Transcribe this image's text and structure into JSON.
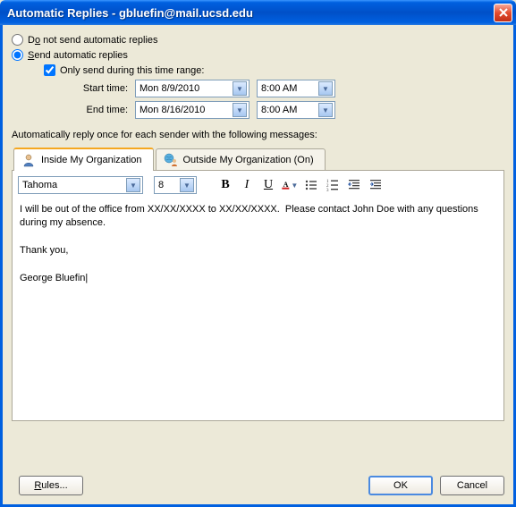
{
  "window": {
    "title": "Automatic Replies - gbluefin@mail.ucsd.edu"
  },
  "radios": {
    "do_not_send": "Do not send automatic replies",
    "send": "Send automatic replies"
  },
  "schedule": {
    "only_range": "Only send during this time range:",
    "start_label": "Start time:",
    "end_label": "End time:",
    "start_date": "Mon 8/9/2010",
    "start_time": "8:00 AM",
    "end_date": "Mon 8/16/2010",
    "end_time": "8:00 AM"
  },
  "section_label": "Automatically reply once for each sender with the following messages:",
  "tabs": {
    "inside": "Inside My Organization",
    "outside": "Outside My Organization (On)"
  },
  "toolbar": {
    "font": "Tahoma",
    "size": "8"
  },
  "message": {
    "body": "I will be out of the office from XX/XX/XXXX to XX/XX/XXXX.  Please contact John Doe with any questions during my absence.\n\nThank you,\n\nGeorge Bluefin|"
  },
  "buttons": {
    "rules": "Rules...",
    "ok": "OK",
    "cancel": "Cancel"
  }
}
